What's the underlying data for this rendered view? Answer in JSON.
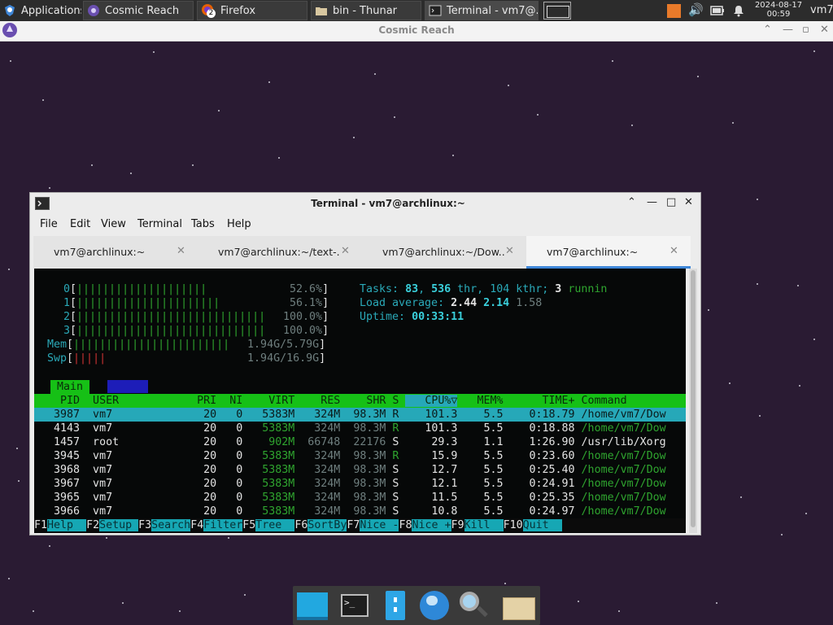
{
  "panel": {
    "apps_label": "Applications",
    "tasks": [
      {
        "label": "Cosmic Reach"
      },
      {
        "label": "Firefox",
        "badge": "2"
      },
      {
        "label": "bin - Thunar"
      },
      {
        "label": "Terminal - vm7@..."
      }
    ],
    "clock_date": "2024-08-17",
    "clock_time": "00:59",
    "user": "vm7"
  },
  "cosmic": {
    "title": "Cosmic Reach"
  },
  "terminal": {
    "title": "Terminal - vm7@archlinux:~",
    "menu": [
      "File",
      "Edit",
      "View",
      "Terminal",
      "Tabs",
      "Help"
    ],
    "tabs": [
      {
        "label": "vm7@archlinux:~"
      },
      {
        "label": "vm7@archlinux:~/text-..."
      },
      {
        "label": "vm7@archlinux:~/Dow..."
      },
      {
        "label": "vm7@archlinux:~"
      }
    ],
    "active_tab": 3
  },
  "htop": {
    "cpus": [
      {
        "id": "0",
        "bar": "||||||||||||||||||||",
        "pct": "52.6%"
      },
      {
        "id": "1",
        "bar": "||||||||||||||||||||||",
        "pct": "56.1%"
      },
      {
        "id": "2",
        "bar": "|||||||||||||||||||||||||||||",
        "pct": "100.0%"
      },
      {
        "id": "3",
        "bar": "|||||||||||||||||||||||||||||",
        "pct": "100.0%"
      }
    ],
    "mem": {
      "label": "Mem",
      "bar": "||||||||||||||||||||||||",
      "value": "1.94G/5.79G"
    },
    "swp": {
      "label": "Swp",
      "bar": "|||||",
      "value": "1.94G/16.9G"
    },
    "tasks_label": "Tasks:",
    "tasks": "83",
    "threads": "536",
    "thr_label": "thr,",
    "kthr": "104",
    "kthr_label": "kthr;",
    "running": "3",
    "running_label": "runnin",
    "load_label": "Load average:",
    "load1": "2.44",
    "load5": "2.14",
    "load15": "1.58",
    "uptime_label": "Uptime:",
    "uptime": "00:33:11",
    "tab_main": "Main",
    "columns": [
      "PID",
      "USER",
      "PRI",
      "NI",
      "VIRT",
      "RES",
      "SHR",
      "S",
      "CPU%▽",
      "MEM%",
      "TIME+",
      "Command"
    ],
    "processes": [
      {
        "pid": "3987",
        "user": "vm7",
        "pri": "20",
        "ni": "0",
        "virt": "5383M",
        "res": "324M",
        "shr": "98.3M",
        "s": "R",
        "cpu": "101.3",
        "mem": "5.5",
        "time": "0:18.79",
        "cmd": "/home/vm7/Dow"
      },
      {
        "pid": "4143",
        "user": "vm7",
        "pri": "20",
        "ni": "0",
        "virt": "5383M",
        "res": "324M",
        "shr": "98.3M",
        "s": "R",
        "cpu": "101.3",
        "mem": "5.5",
        "time": "0:18.88",
        "cmd": "/home/vm7/Dow"
      },
      {
        "pid": "1457",
        "user": "root",
        "pri": "20",
        "ni": "0",
        "virt": "902M",
        "res": "66748",
        "shr": "22176",
        "s": "S",
        "cpu": "29.3",
        "mem": "1.1",
        "time": "1:26.90",
        "cmd": "/usr/lib/Xorg"
      },
      {
        "pid": "3945",
        "user": "vm7",
        "pri": "20",
        "ni": "0",
        "virt": "5383M",
        "res": "324M",
        "shr": "98.3M",
        "s": "R",
        "cpu": "15.9",
        "mem": "5.5",
        "time": "0:23.60",
        "cmd": "/home/vm7/Dow"
      },
      {
        "pid": "3968",
        "user": "vm7",
        "pri": "20",
        "ni": "0",
        "virt": "5383M",
        "res": "324M",
        "shr": "98.3M",
        "s": "S",
        "cpu": "12.7",
        "mem": "5.5",
        "time": "0:25.40",
        "cmd": "/home/vm7/Dow"
      },
      {
        "pid": "3967",
        "user": "vm7",
        "pri": "20",
        "ni": "0",
        "virt": "5383M",
        "res": "324M",
        "shr": "98.3M",
        "s": "S",
        "cpu": "12.1",
        "mem": "5.5",
        "time": "0:24.91",
        "cmd": "/home/vm7/Dow"
      },
      {
        "pid": "3965",
        "user": "vm7",
        "pri": "20",
        "ni": "0",
        "virt": "5383M",
        "res": "324M",
        "shr": "98.3M",
        "s": "S",
        "cpu": "11.5",
        "mem": "5.5",
        "time": "0:25.35",
        "cmd": "/home/vm7/Dow"
      },
      {
        "pid": "3966",
        "user": "vm7",
        "pri": "20",
        "ni": "0",
        "virt": "5383M",
        "res": "324M",
        "shr": "98.3M",
        "s": "S",
        "cpu": "10.8",
        "mem": "5.5",
        "time": "0:24.97",
        "cmd": "/home/vm7/Dow"
      }
    ],
    "fkeys": [
      {
        "key": "F1",
        "label": "Help  "
      },
      {
        "key": "F2",
        "label": "Setup "
      },
      {
        "key": "F3",
        "label": "Search"
      },
      {
        "key": "F4",
        "label": "Filter"
      },
      {
        "key": "F5",
        "label": "Tree  "
      },
      {
        "key": "F6",
        "label": "SortBy"
      },
      {
        "key": "F7",
        "label": "Nice -"
      },
      {
        "key": "F8",
        "label": "Nice +"
      },
      {
        "key": "F9",
        "label": "Kill  "
      },
      {
        "key": "F10",
        "label": "Quit  "
      }
    ]
  },
  "colors": {
    "desktop": "#2a1b33",
    "htop_header": "#16c016",
    "htop_selected": "#26a8b8",
    "tab_accent": "#3f87d8"
  },
  "dock": {
    "icons": [
      "desktop-icon",
      "terminal-icon",
      "file-manager-icon",
      "web-browser-icon",
      "search-icon",
      "folder-icon"
    ]
  }
}
